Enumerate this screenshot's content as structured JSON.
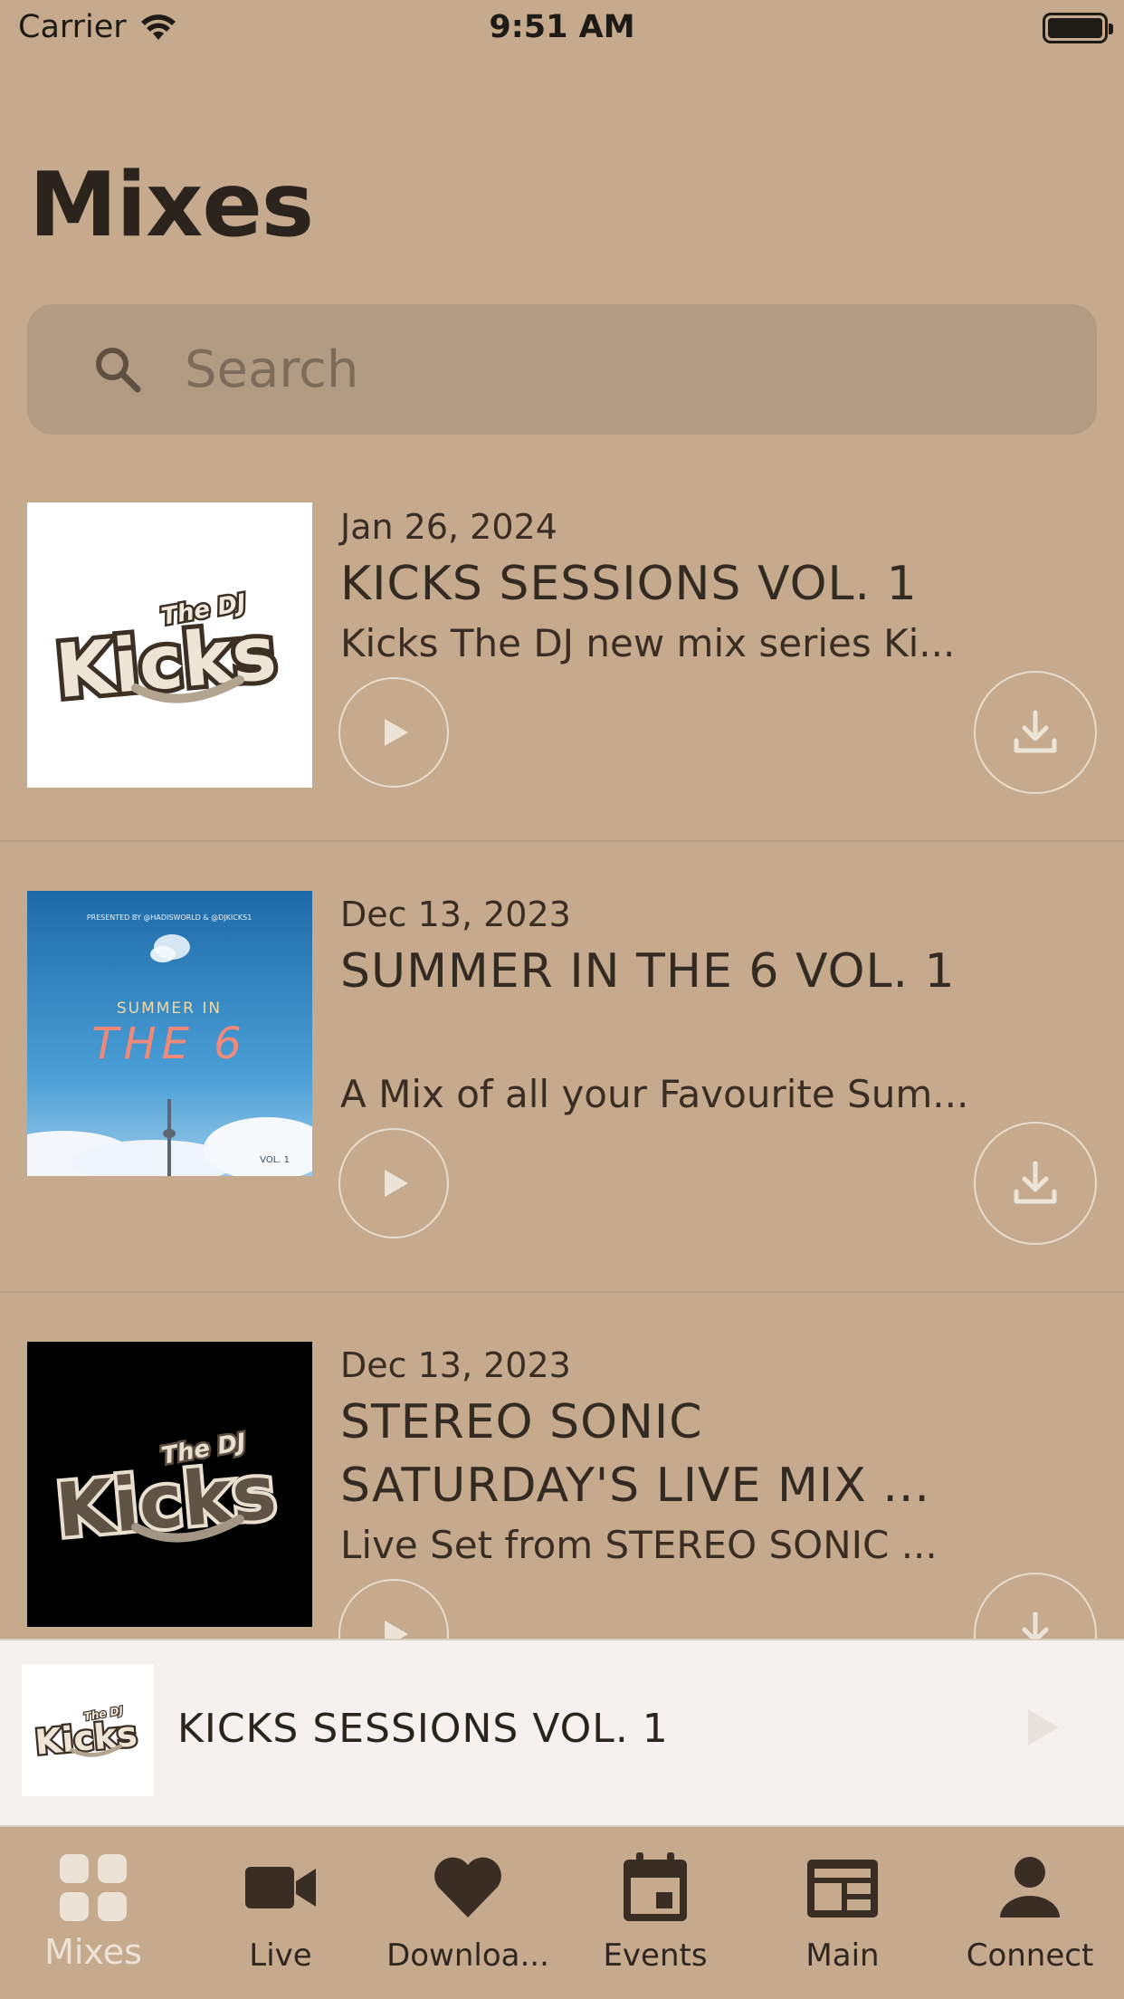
{
  "status_bar": {
    "carrier": "Carrier",
    "time": "9:51 AM"
  },
  "page": {
    "title": "Mixes"
  },
  "search": {
    "placeholder": "Search"
  },
  "mixes": [
    {
      "date": "Jan 26, 2024",
      "title": "KICKS SESSIONS VOL. 1",
      "description": "Kicks The DJ new mix series Ki..."
    },
    {
      "date": "Dec 13, 2023",
      "title": "SUMMER IN THE 6 VOL. 1",
      "description": "A Mix of all your Favourite Sum...",
      "art": {
        "presented": "PRESENTED BY @HADISWORLD & @DJKICKS1",
        "line1": "SUMMER IN",
        "line2": "THE 6",
        "vol": "VOL. 1"
      }
    },
    {
      "date": "Dec 13, 2023",
      "title": "STEREO SONIC SATURDAY'S LIVE MIX ...",
      "description": "Live Set from STEREO SONIC ..."
    }
  ],
  "logo": {
    "small_text": "The DJ",
    "big_text": "Kicks"
  },
  "mini_player": {
    "title": "KICKS SESSIONS VOL. 1"
  },
  "tabs": [
    {
      "label": "Mixes",
      "icon": "grid-icon",
      "active": true
    },
    {
      "label": "Live",
      "icon": "video-camera-icon"
    },
    {
      "label": "Downloa...",
      "icon": "heart-icon"
    },
    {
      "label": "Events",
      "icon": "calendar-icon"
    },
    {
      "label": "Main",
      "icon": "newspaper-icon"
    },
    {
      "label": "Connect",
      "icon": "person-icon"
    }
  ],
  "colors": {
    "background": "#c6aa8d",
    "search_bg": "#b19b82",
    "mini_player_bg": "#f4f1ee",
    "active_tab": "#ece2d5",
    "text_dark": "#2b241d"
  }
}
